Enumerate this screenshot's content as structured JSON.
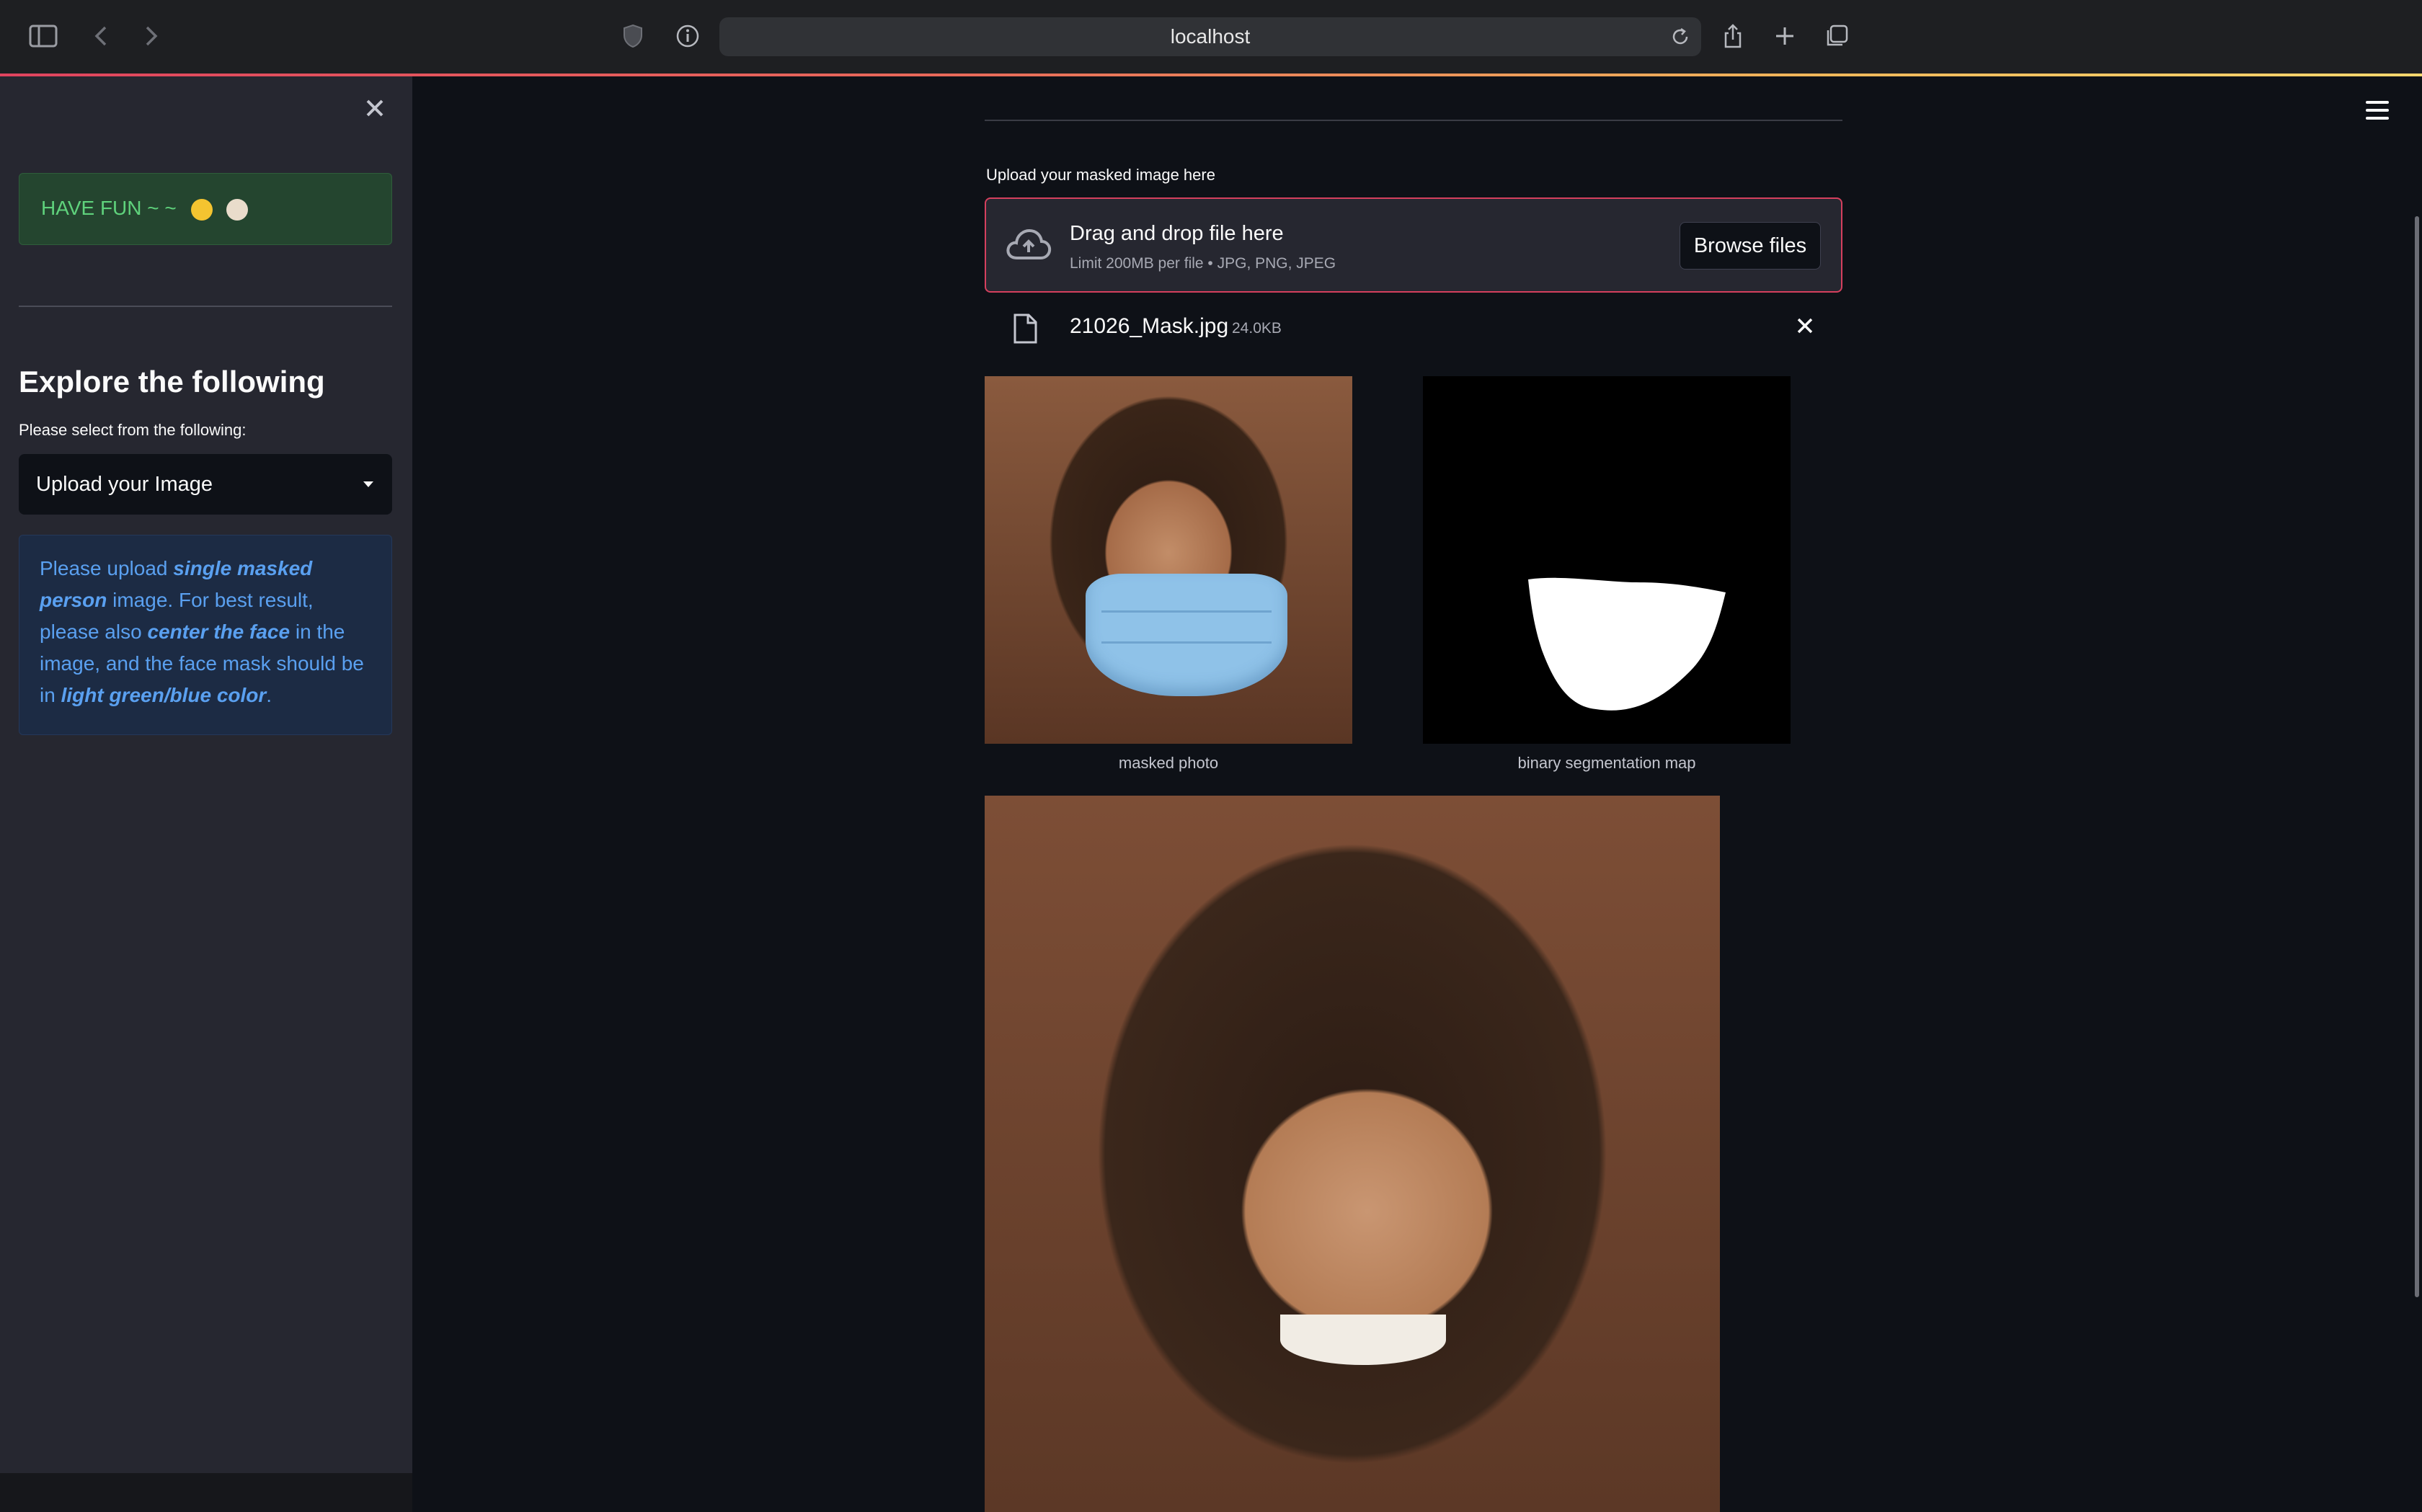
{
  "browser": {
    "url": "localhost",
    "icons": [
      "sidebar-toggle-icon",
      "back-icon",
      "forward-icon",
      "privacy-shield-icon",
      "info-icon",
      "reload-icon",
      "share-icon",
      "new-tab-icon",
      "tabs-overview-icon"
    ]
  },
  "sidebar": {
    "fun_text": "HAVE FUN ~ ~",
    "heading": "Explore the following",
    "select_label": "Please select from the following:",
    "select_value": "Upload your Image",
    "info": {
      "t1": "Please upload ",
      "b1": "single masked person",
      "t2": " image. For best result, please also ",
      "b2": "center the face",
      "t3": " in the image, and the face mask should be in ",
      "b3": "light green/blue color",
      "t4": "."
    }
  },
  "uploader": {
    "label": "Upload your masked image here",
    "drag_text": "Drag and drop file here",
    "limit_text": "Limit 200MB per file • JPG, PNG, JPEG",
    "browse_label": "Browse files",
    "file_name": "21026_Mask.jpg",
    "file_size": "24.0KB"
  },
  "images": {
    "masked_caption": "masked photo",
    "segmentation_caption": "binary segmentation map"
  },
  "colors": {
    "accent": "#ff4b4b",
    "background": "#0e1117",
    "sidebar": "#262730",
    "success_text": "#5fd27c",
    "info_text": "#5aa0f0"
  }
}
